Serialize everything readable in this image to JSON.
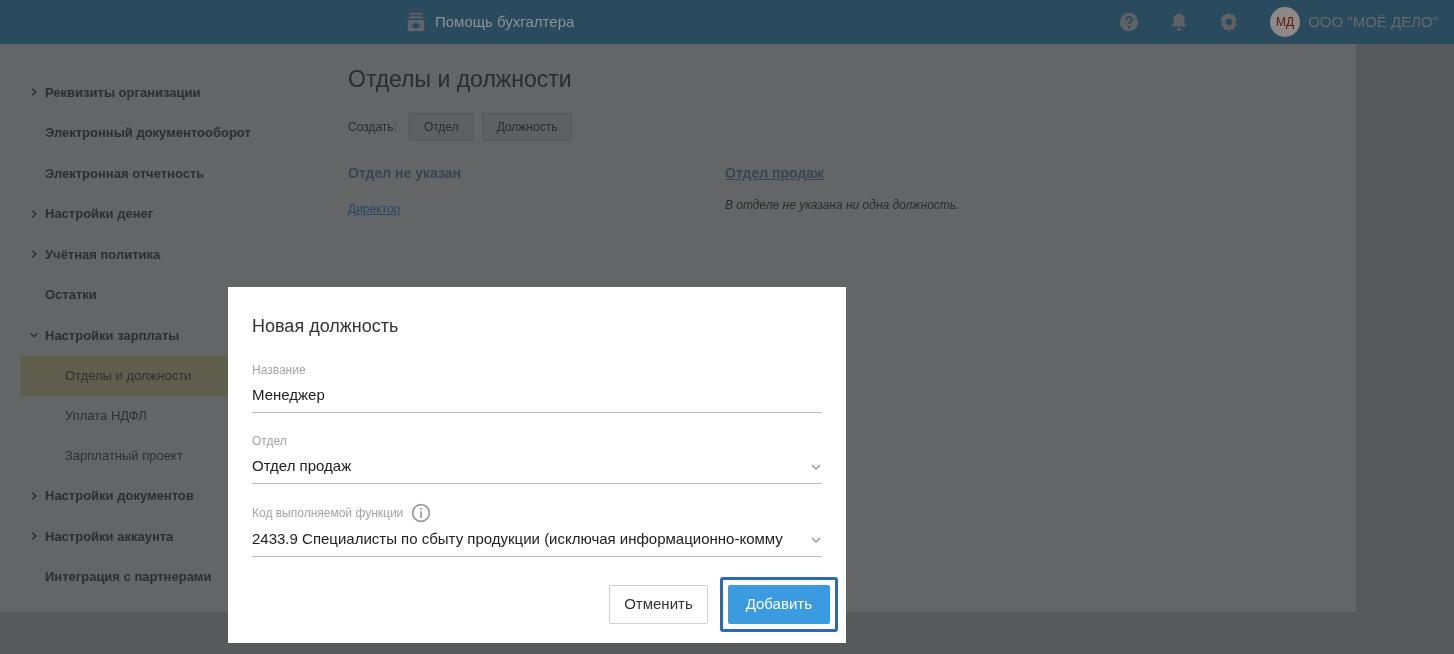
{
  "header": {
    "app_title": "Помощь бухгалтера",
    "avatar": "МД",
    "company": "ООО \"МОЁ ДЕЛО\""
  },
  "sidebar": {
    "items": [
      {
        "label": "Реквизиты организации",
        "kind": "group",
        "expanded": false
      },
      {
        "label": "Электронный документооборот",
        "kind": "link"
      },
      {
        "label": "Электронная отчетность",
        "kind": "link"
      },
      {
        "label": "Настройки денег",
        "kind": "group",
        "expanded": false
      },
      {
        "label": "Учётная политика",
        "kind": "group",
        "expanded": false
      },
      {
        "label": "Остатки",
        "kind": "link"
      },
      {
        "label": "Настройки зарплаты",
        "kind": "group",
        "expanded": true,
        "children": [
          {
            "label": "Отделы и должности",
            "selected": true
          },
          {
            "label": "Уплата НДФЛ",
            "selected": false
          },
          {
            "label": "Зарплатный проект",
            "selected": false
          }
        ]
      },
      {
        "label": "Настройки документов",
        "kind": "group",
        "expanded": false
      },
      {
        "label": "Настройки аккаунта",
        "kind": "group",
        "expanded": false
      },
      {
        "label": "Интеграция с партнерами",
        "kind": "link"
      }
    ]
  },
  "main": {
    "title": "Отделы и должности",
    "create_label": "Создать:",
    "create_buttons": [
      "Отдел",
      "Должность"
    ],
    "departments": [
      {
        "name": "Отдел не указан",
        "link": false,
        "positions": [
          "Директор"
        ]
      },
      {
        "name": "Отдел продаж",
        "link": true,
        "empty_text": "В отделе не указана ни одна должность."
      }
    ]
  },
  "dialog": {
    "title": "Новая должность",
    "fields": [
      {
        "kind": "text",
        "label": "Название",
        "value": "Менеджер"
      },
      {
        "kind": "select",
        "label": "Отдел",
        "value": "Отдел продаж"
      },
      {
        "kind": "select",
        "label": "Код выполняемой функции",
        "info": true,
        "value": "2433.9 Специалисты по сбыту продукции (исключая информационно-комму"
      }
    ],
    "buttons": [
      {
        "label": "Отменить",
        "kind": "secondary",
        "focused": false
      },
      {
        "label": "Добавить",
        "kind": "primary",
        "focused": true
      }
    ]
  }
}
